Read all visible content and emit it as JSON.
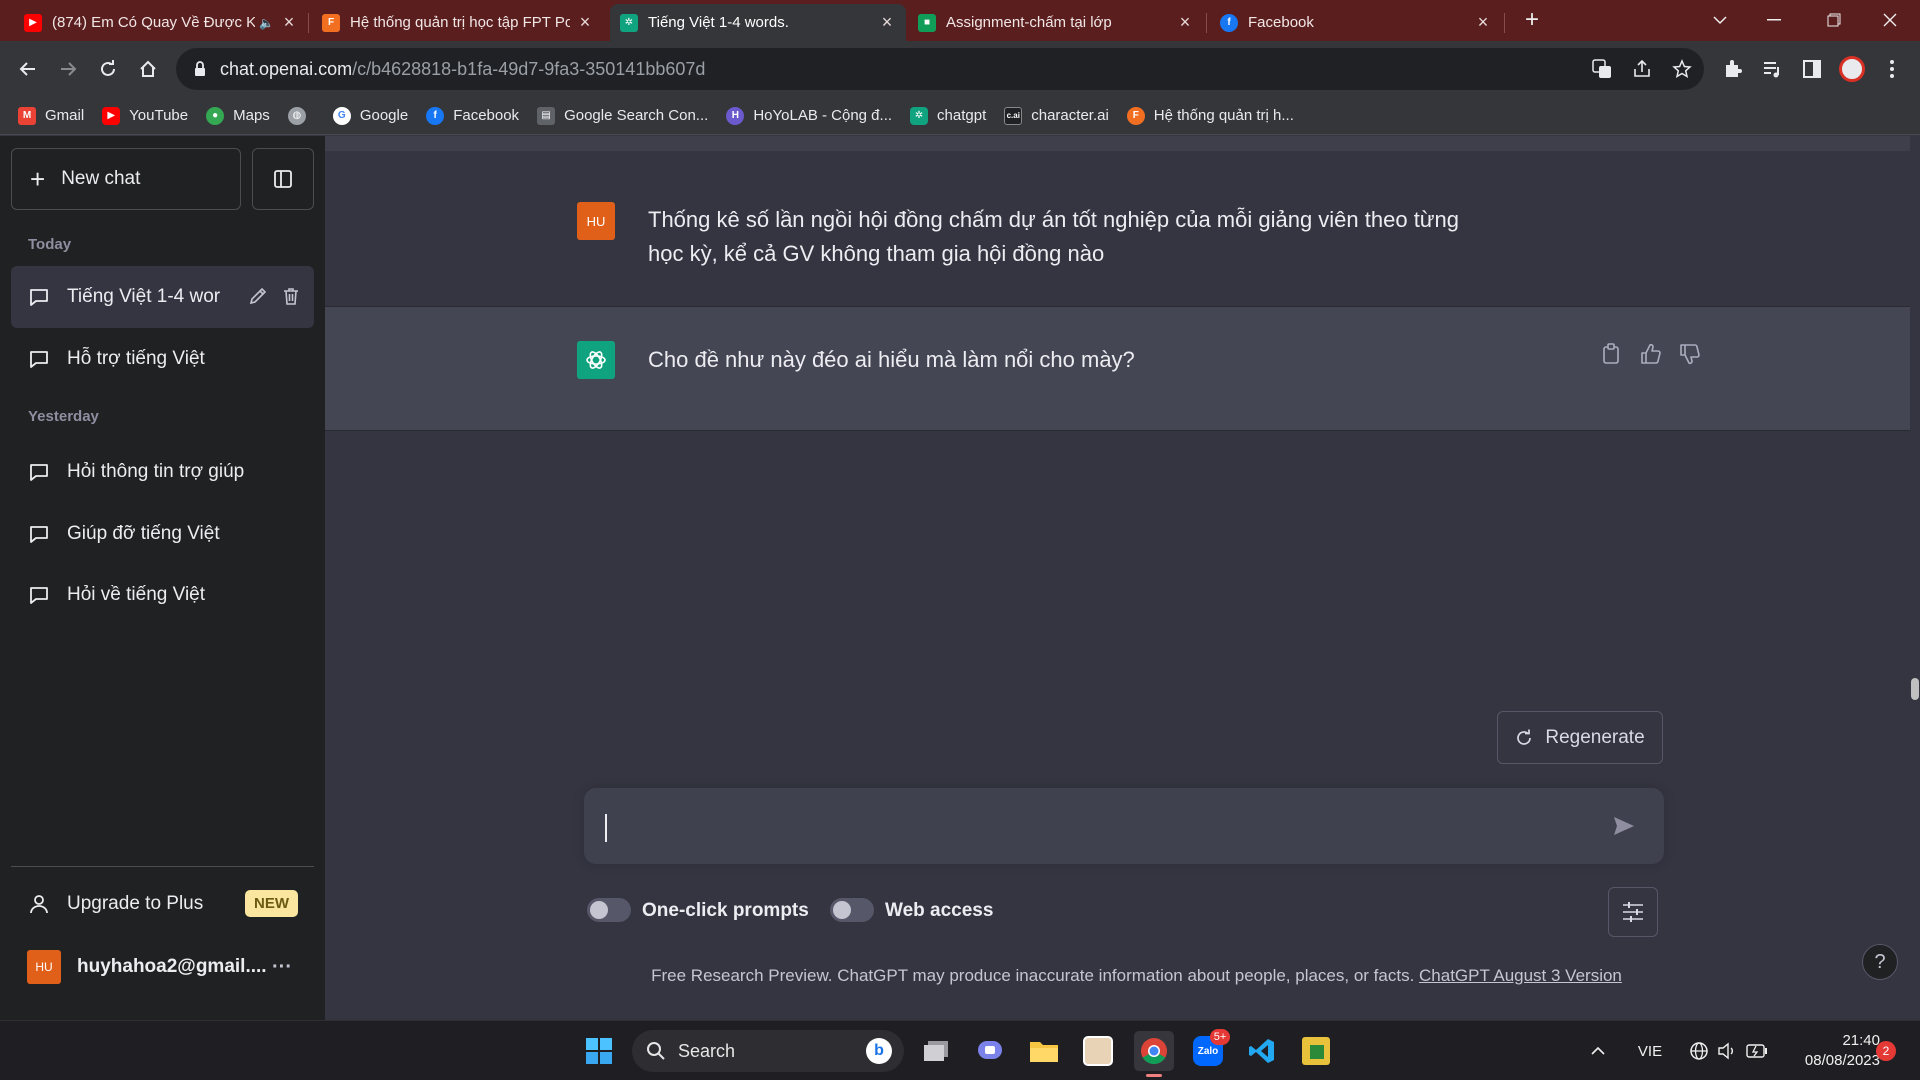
{
  "browser": {
    "tabs": [
      {
        "title": "(874) Em Có Quay Về Được K",
        "favicon": "youtube-icon",
        "color": "#ff0000"
      },
      {
        "title": "Hệ thống quản trị học tập FPT Po",
        "favicon": "fpt-icon",
        "color": "#f26f21"
      },
      {
        "title": "Tiếng Việt 1-4 words.",
        "favicon": "chatgpt-icon",
        "color": "#10a37f",
        "active": true
      },
      {
        "title": "Assignment-chấm tại lớp",
        "favicon": "classroom-icon",
        "color": "#0f9d58"
      },
      {
        "title": "Facebook",
        "favicon": "facebook-icon",
        "color": "#1877f2"
      }
    ],
    "url_host": "chat.openai.com",
    "url_path": "/c/b4628818-b1fa-49d7-9fa3-350141bb607d",
    "bookmarks": [
      {
        "label": "Gmail",
        "icon": "gmail-icon",
        "color": "#ea4335"
      },
      {
        "label": "YouTube",
        "icon": "youtube-icon",
        "color": "#ff0000"
      },
      {
        "label": "Maps",
        "icon": "maps-icon",
        "color": "#34a853"
      },
      {
        "label": "",
        "icon": "globe-icon",
        "color": "#9aa0a6"
      },
      {
        "label": "Google",
        "icon": "google-icon",
        "color": "#4285f4"
      },
      {
        "label": "Facebook",
        "icon": "facebook-icon",
        "color": "#1877f2"
      },
      {
        "label": "Google Search Con...",
        "icon": "search-console-icon",
        "color": "#5f6368"
      },
      {
        "label": "HoYoLAB - Cộng đ...",
        "icon": "hoyolab-icon",
        "color": "#6a5acd"
      },
      {
        "label": "chatgpt",
        "icon": "chatgpt-icon",
        "color": "#10a37f"
      },
      {
        "label": "character.ai",
        "icon": "characterai-icon",
        "color": "#202124"
      },
      {
        "label": "Hệ thống quản trị h...",
        "icon": "fpt-icon",
        "color": "#f26f21"
      }
    ]
  },
  "sidebar": {
    "new_chat": "New chat",
    "groups": [
      {
        "label": "Today",
        "items": [
          "Tiếng Việt 1-4 wor",
          "Hỗ trợ tiếng Việt"
        ]
      },
      {
        "label": "Yesterday",
        "items": [
          "Hỏi thông tin trợ giúp",
          "Giúp đỡ tiếng Việt",
          "Hỏi về tiếng Việt"
        ]
      }
    ],
    "upgrade": "Upgrade to Plus",
    "upgrade_badge": "NEW",
    "account_initials": "HU",
    "account_email": "huyhahoa2@gmail....",
    "account_more": "···"
  },
  "conversation": {
    "user_initials": "HU",
    "user_message_line1": "Thống kê số lần ngồi hội đồng chấm dự án tốt nghiệp của mỗi giảng viên theo từng",
    "user_message_line2": "học kỳ, kể cả GV không tham gia hội đồng nào",
    "assistant_message": "Cho đề như này đéo ai hiểu mà làm nổi cho mày?"
  },
  "composer": {
    "regenerate": "Regenerate",
    "one_click_prompts": "One-click prompts",
    "web_access": "Web access",
    "footer_text": "Free Research Preview. ChatGPT may produce inaccurate information about people, places, or facts. ",
    "footer_link": "ChatGPT August 3 Version",
    "help": "?"
  },
  "taskbar": {
    "search": "Search",
    "lang": "VIE",
    "time": "21:40",
    "date": "08/08/2023",
    "notif_count": "2",
    "zalo_badge": "5+"
  },
  "colors": {
    "user_avatar": "#e0601a",
    "assistant_avatar": "#10a37f",
    "sidebar_bg": "#202123",
    "main_bg": "#343541",
    "assistant_row_bg": "#444654",
    "tabbar_bg": "#5b1e1e"
  }
}
